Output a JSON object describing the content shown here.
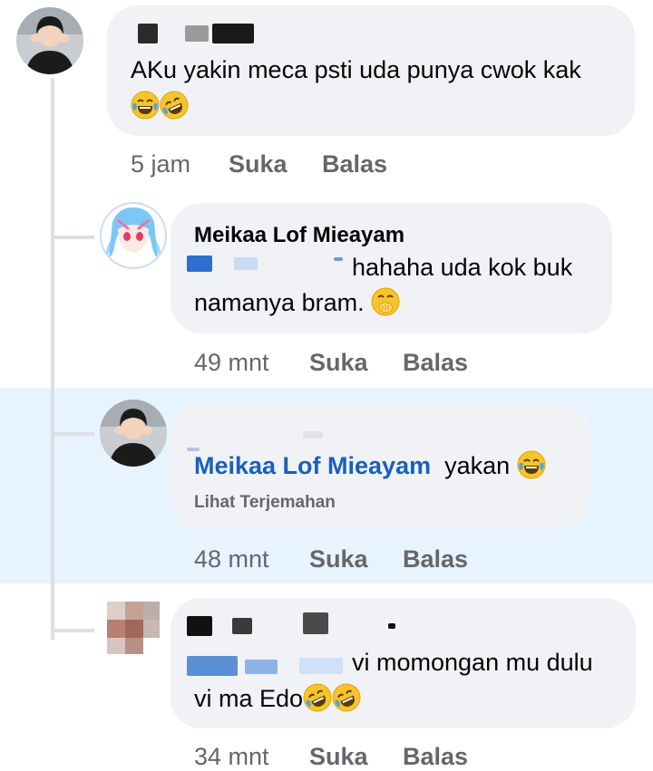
{
  "colors": {
    "bubble": "#f0f2f5",
    "highlight": "#e7f3ff",
    "mention": "#1b5fbd",
    "meta": "#65676b"
  },
  "comments": [
    {
      "author_visible": false,
      "text": "AKu yakin meca psti uda punya cwok kak",
      "emojis": [
        "laughing-tears-emoji",
        "rolling-laughing-emoji"
      ],
      "time": "5 jam",
      "like": "Suka",
      "reply": "Balas"
    },
    {
      "author": "Meikaa Lof Mieayam",
      "text_line1": "hahaha uda kok buk",
      "text_line2": "namanya bram.",
      "emojis": [
        "hand-over-mouth-emoji"
      ],
      "time": "49 mnt",
      "like": "Suka",
      "reply": "Balas"
    },
    {
      "mention": "Meikaa Lof Mieayam",
      "text": "yakan",
      "emojis": [
        "laughing-tears-emoji"
      ],
      "see_translation": "Lihat Terjemahan",
      "time": "48 mnt",
      "like": "Suka",
      "reply": "Balas"
    },
    {
      "text_line1": "vi momongan mu dulu",
      "text_line2": "vi ma Edo",
      "emojis": [
        "rolling-laughing-emoji",
        "rolling-laughing-emoji"
      ],
      "time": "34 mnt",
      "like": "Suka",
      "reply": "Balas"
    }
  ]
}
